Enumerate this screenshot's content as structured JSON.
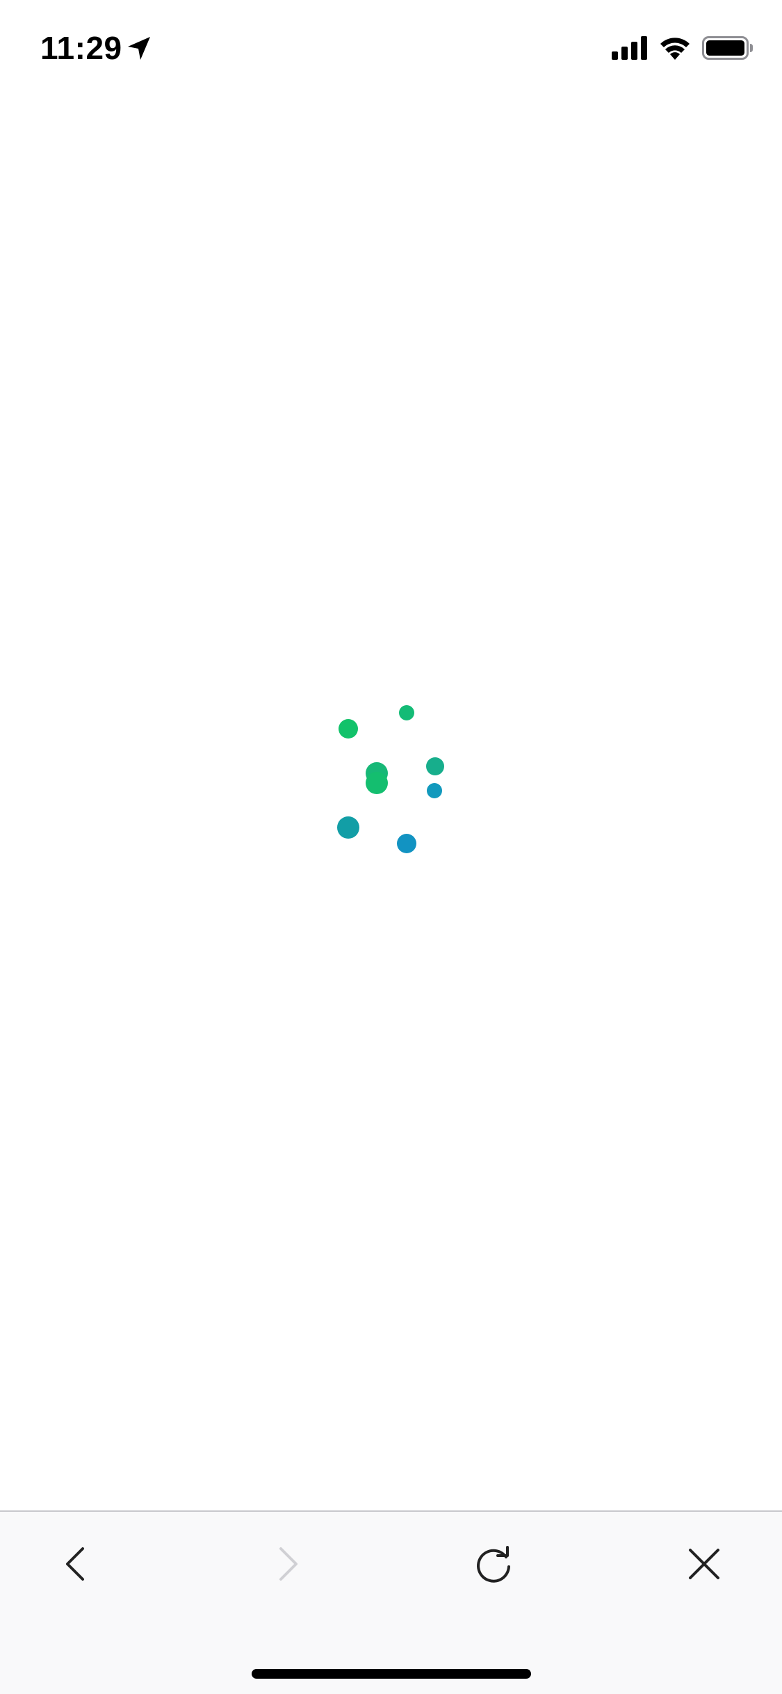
{
  "status_bar": {
    "time": "11:29",
    "location_icon": "location-arrow-icon",
    "signal_icon": "cellular-signal-icon",
    "wifi_icon": "wifi-icon",
    "battery_icon": "battery-icon"
  },
  "loading": {
    "icon": "loading-dots-spinner",
    "colors": [
      "#12c26a",
      "#1ab77e",
      "#17a98e",
      "#1296b3",
      "#129ec4"
    ]
  },
  "toolbar": {
    "back_icon": "chevron-left-icon",
    "forward_icon": "chevron-right-icon",
    "reload_icon": "reload-icon",
    "close_icon": "close-icon",
    "forward_enabled": false
  },
  "colors": {
    "toolbar_bg": "#f9f9fa",
    "icon_active": "#222222",
    "icon_disabled": "#d0d0d4",
    "divider": "#c8c8cc"
  }
}
